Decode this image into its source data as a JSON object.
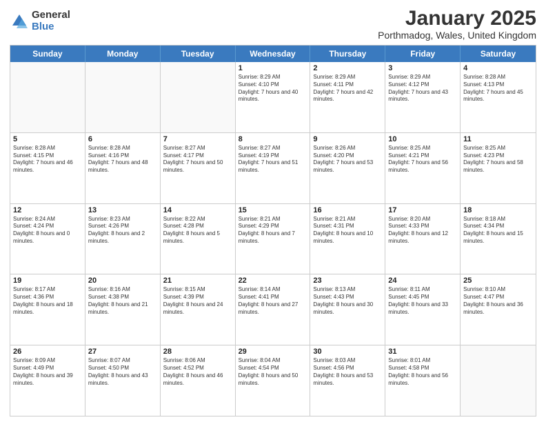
{
  "logo": {
    "general": "General",
    "blue": "Blue"
  },
  "title": "January 2025",
  "subtitle": "Porthmadog, Wales, United Kingdom",
  "headers": [
    "Sunday",
    "Monday",
    "Tuesday",
    "Wednesday",
    "Thursday",
    "Friday",
    "Saturday"
  ],
  "weeks": [
    [
      {
        "day": "",
        "sunrise": "",
        "sunset": "",
        "daylight": ""
      },
      {
        "day": "",
        "sunrise": "",
        "sunset": "",
        "daylight": ""
      },
      {
        "day": "",
        "sunrise": "",
        "sunset": "",
        "daylight": ""
      },
      {
        "day": "1",
        "sunrise": "Sunrise: 8:29 AM",
        "sunset": "Sunset: 4:10 PM",
        "daylight": "Daylight: 7 hours and 40 minutes."
      },
      {
        "day": "2",
        "sunrise": "Sunrise: 8:29 AM",
        "sunset": "Sunset: 4:11 PM",
        "daylight": "Daylight: 7 hours and 42 minutes."
      },
      {
        "day": "3",
        "sunrise": "Sunrise: 8:29 AM",
        "sunset": "Sunset: 4:12 PM",
        "daylight": "Daylight: 7 hours and 43 minutes."
      },
      {
        "day": "4",
        "sunrise": "Sunrise: 8:28 AM",
        "sunset": "Sunset: 4:13 PM",
        "daylight": "Daylight: 7 hours and 45 minutes."
      }
    ],
    [
      {
        "day": "5",
        "sunrise": "Sunrise: 8:28 AM",
        "sunset": "Sunset: 4:15 PM",
        "daylight": "Daylight: 7 hours and 46 minutes."
      },
      {
        "day": "6",
        "sunrise": "Sunrise: 8:28 AM",
        "sunset": "Sunset: 4:16 PM",
        "daylight": "Daylight: 7 hours and 48 minutes."
      },
      {
        "day": "7",
        "sunrise": "Sunrise: 8:27 AM",
        "sunset": "Sunset: 4:17 PM",
        "daylight": "Daylight: 7 hours and 50 minutes."
      },
      {
        "day": "8",
        "sunrise": "Sunrise: 8:27 AM",
        "sunset": "Sunset: 4:19 PM",
        "daylight": "Daylight: 7 hours and 51 minutes."
      },
      {
        "day": "9",
        "sunrise": "Sunrise: 8:26 AM",
        "sunset": "Sunset: 4:20 PM",
        "daylight": "Daylight: 7 hours and 53 minutes."
      },
      {
        "day": "10",
        "sunrise": "Sunrise: 8:25 AM",
        "sunset": "Sunset: 4:21 PM",
        "daylight": "Daylight: 7 hours and 56 minutes."
      },
      {
        "day": "11",
        "sunrise": "Sunrise: 8:25 AM",
        "sunset": "Sunset: 4:23 PM",
        "daylight": "Daylight: 7 hours and 58 minutes."
      }
    ],
    [
      {
        "day": "12",
        "sunrise": "Sunrise: 8:24 AM",
        "sunset": "Sunset: 4:24 PM",
        "daylight": "Daylight: 8 hours and 0 minutes."
      },
      {
        "day": "13",
        "sunrise": "Sunrise: 8:23 AM",
        "sunset": "Sunset: 4:26 PM",
        "daylight": "Daylight: 8 hours and 2 minutes."
      },
      {
        "day": "14",
        "sunrise": "Sunrise: 8:22 AM",
        "sunset": "Sunset: 4:28 PM",
        "daylight": "Daylight: 8 hours and 5 minutes."
      },
      {
        "day": "15",
        "sunrise": "Sunrise: 8:21 AM",
        "sunset": "Sunset: 4:29 PM",
        "daylight": "Daylight: 8 hours and 7 minutes."
      },
      {
        "day": "16",
        "sunrise": "Sunrise: 8:21 AM",
        "sunset": "Sunset: 4:31 PM",
        "daylight": "Daylight: 8 hours and 10 minutes."
      },
      {
        "day": "17",
        "sunrise": "Sunrise: 8:20 AM",
        "sunset": "Sunset: 4:33 PM",
        "daylight": "Daylight: 8 hours and 12 minutes."
      },
      {
        "day": "18",
        "sunrise": "Sunrise: 8:18 AM",
        "sunset": "Sunset: 4:34 PM",
        "daylight": "Daylight: 8 hours and 15 minutes."
      }
    ],
    [
      {
        "day": "19",
        "sunrise": "Sunrise: 8:17 AM",
        "sunset": "Sunset: 4:36 PM",
        "daylight": "Daylight: 8 hours and 18 minutes."
      },
      {
        "day": "20",
        "sunrise": "Sunrise: 8:16 AM",
        "sunset": "Sunset: 4:38 PM",
        "daylight": "Daylight: 8 hours and 21 minutes."
      },
      {
        "day": "21",
        "sunrise": "Sunrise: 8:15 AM",
        "sunset": "Sunset: 4:39 PM",
        "daylight": "Daylight: 8 hours and 24 minutes."
      },
      {
        "day": "22",
        "sunrise": "Sunrise: 8:14 AM",
        "sunset": "Sunset: 4:41 PM",
        "daylight": "Daylight: 8 hours and 27 minutes."
      },
      {
        "day": "23",
        "sunrise": "Sunrise: 8:13 AM",
        "sunset": "Sunset: 4:43 PM",
        "daylight": "Daylight: 8 hours and 30 minutes."
      },
      {
        "day": "24",
        "sunrise": "Sunrise: 8:11 AM",
        "sunset": "Sunset: 4:45 PM",
        "daylight": "Daylight: 8 hours and 33 minutes."
      },
      {
        "day": "25",
        "sunrise": "Sunrise: 8:10 AM",
        "sunset": "Sunset: 4:47 PM",
        "daylight": "Daylight: 8 hours and 36 minutes."
      }
    ],
    [
      {
        "day": "26",
        "sunrise": "Sunrise: 8:09 AM",
        "sunset": "Sunset: 4:49 PM",
        "daylight": "Daylight: 8 hours and 39 minutes."
      },
      {
        "day": "27",
        "sunrise": "Sunrise: 8:07 AM",
        "sunset": "Sunset: 4:50 PM",
        "daylight": "Daylight: 8 hours and 43 minutes."
      },
      {
        "day": "28",
        "sunrise": "Sunrise: 8:06 AM",
        "sunset": "Sunset: 4:52 PM",
        "daylight": "Daylight: 8 hours and 46 minutes."
      },
      {
        "day": "29",
        "sunrise": "Sunrise: 8:04 AM",
        "sunset": "Sunset: 4:54 PM",
        "daylight": "Daylight: 8 hours and 50 minutes."
      },
      {
        "day": "30",
        "sunrise": "Sunrise: 8:03 AM",
        "sunset": "Sunset: 4:56 PM",
        "daylight": "Daylight: 8 hours and 53 minutes."
      },
      {
        "day": "31",
        "sunrise": "Sunrise: 8:01 AM",
        "sunset": "Sunset: 4:58 PM",
        "daylight": "Daylight: 8 hours and 56 minutes."
      },
      {
        "day": "",
        "sunrise": "",
        "sunset": "",
        "daylight": ""
      }
    ]
  ]
}
